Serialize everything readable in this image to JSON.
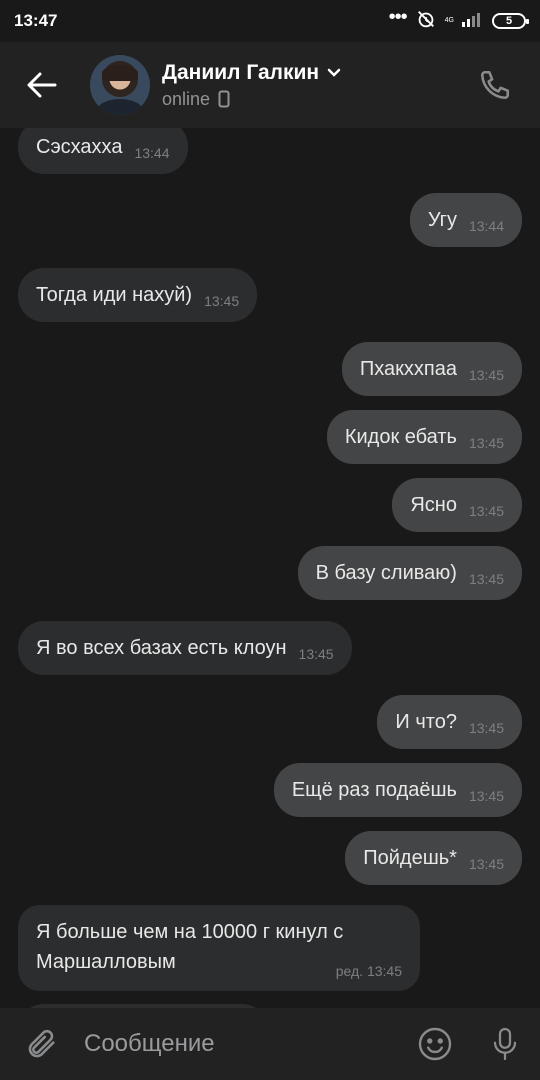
{
  "status_bar": {
    "time": "13:47",
    "network": "4G",
    "battery": "5"
  },
  "header": {
    "name": "Даниил Галкин",
    "status": "online"
  },
  "messages": [
    {
      "dir": "in",
      "text": "Сэсхахха",
      "time": "13:44"
    },
    {
      "dir": "out",
      "text": "Угу",
      "time": "13:44"
    },
    {
      "dir": "in",
      "text": "Тогда иди нахуй)",
      "time": "13:45"
    },
    {
      "dir": "out",
      "text": "Пхакххпаа",
      "time": "13:45"
    },
    {
      "dir": "out",
      "text": "Кидок ебать",
      "time": "13:45"
    },
    {
      "dir": "out",
      "text": "Ясно",
      "time": "13:45"
    },
    {
      "dir": "out",
      "text": "В базу сливаю)",
      "time": "13:45"
    },
    {
      "dir": "in",
      "text": "Я во всех базах есть клоун",
      "time": "13:45"
    },
    {
      "dir": "out",
      "text": "И что?",
      "time": "13:45"
    },
    {
      "dir": "out",
      "text": "Ещё раз подаёшь",
      "time": "13:45"
    },
    {
      "dir": "out",
      "text": "Пойдешь*",
      "time": "13:45"
    },
    {
      "dir": "in",
      "text": "Я больше чем на 10000 г кинул с Маршалловым",
      "time": "ред. 13:45"
    }
  ],
  "composer": {
    "placeholder": "Сообщение"
  }
}
